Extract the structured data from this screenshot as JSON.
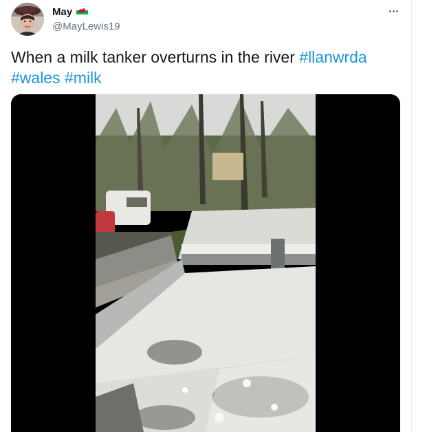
{
  "user": {
    "display_name": "May",
    "flag_icon": "wales-flag-icon",
    "handle": "@MayLewis19"
  },
  "menu": {
    "icon": "more-options-icon"
  },
  "tweet": {
    "text": "When a milk tanker overturns in the river",
    "hashtags": [
      "#llanwrda",
      "#wales",
      "#milk"
    ]
  },
  "media": {
    "type": "video",
    "description_icon": "video-frame-icon"
  },
  "colors": {
    "hashtag": "#1b95e0",
    "handle": "#657786",
    "text": "#14171a"
  }
}
